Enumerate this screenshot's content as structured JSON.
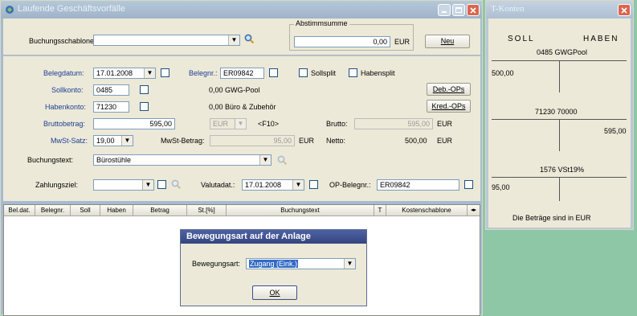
{
  "main_window": {
    "title": "Laufende Geschäftsvorfälle",
    "buchungsschablone_label": "Buchungsschablone:",
    "buchungsschablone_value": "",
    "abstimmsumme_label": "Abstimmsumme",
    "abstimmsumme_value": "0,00",
    "abstimmsumme_currency": "EUR",
    "neu_button": "Neu"
  },
  "form": {
    "belegdatum_label": "Belegdatum:",
    "belegdatum_value": "17.01.2008",
    "belegnr_label": "Belegnr.:",
    "belegnr_value": "ER09842",
    "sollsplit_label": "Sollsplit",
    "habensplit_label": "Habensplit",
    "sollkonto_label": "Sollkonto:",
    "sollkonto_value": "0485",
    "sollkonto_info": "0,00  GWG-Pool",
    "habenkonto_label": "Habenkonto:",
    "habenkonto_value": "71230",
    "habenkonto_info": "0,00  Büro & Zubehör",
    "deb_ops_button": "Deb.-OPs",
    "kred_ops_button": "Kred.-OPs",
    "bruttobetrag_label": "Bruttobetrag:",
    "bruttobetrag_value": "595,00",
    "currency_select": "EUR",
    "f10_hint": "<F10>",
    "brutto_label": "Brutto:",
    "brutto_value": "595,00",
    "brutto_currency": "EUR",
    "mwst_satz_label": "MwSt-Satz:",
    "mwst_satz_value": "19,00",
    "mwst_betrag_label": "MwSt-Betrag:",
    "mwst_betrag_value": "95,00",
    "mwst_betrag_currency": "EUR",
    "netto_label": "Netto:",
    "netto_value": "500,00",
    "netto_currency": "EUR",
    "buchungstext_label": "Buchungstext:",
    "buchungstext_value": "Bürostühle",
    "zahlungsziel_label": "Zahlungsziel:",
    "zahlungsziel_value": "",
    "valutadat_label": "Valutadat.:",
    "valutadat_value": "17.01.2008",
    "op_belegnr_label": "OP-Belegnr.:",
    "op_belegnr_value": "ER09842"
  },
  "table": {
    "columns": [
      "Bel.dat.",
      "Belegnr.",
      "Soll",
      "Haben",
      "Betrag",
      "St.[%]",
      "Buchungstext",
      "T",
      "Kostenschablone"
    ]
  },
  "dialog": {
    "title": "Bewegungsart auf der Anlage",
    "bewegungsart_label": "Bewegungsart:",
    "bewegungsart_value": "Zugang (Eink.)",
    "ok_button": "OK"
  },
  "tkonten": {
    "title": "T-Konten",
    "soll_header": "SOLL",
    "haben_header": "HABEN",
    "account1_name": "0485 GWGPool",
    "account1_soll": "500,00",
    "account1_haben": "",
    "account2_name": "71230 70000",
    "account2_soll": "",
    "account2_haben": "595,00",
    "account3_name": "1576 VSt19%",
    "account3_soll": "95,00",
    "account3_haben": "",
    "footer": "Die Beträge sind in EUR"
  },
  "colors": {
    "desktop": "#8dc7a6",
    "titlebar_inactive": "#a7bbd0",
    "titlebar_tkonten": "#b9c7d8",
    "close_button": "#d9664e",
    "dialog_title": "#3c4e8e",
    "panel": "#ece9d8"
  }
}
